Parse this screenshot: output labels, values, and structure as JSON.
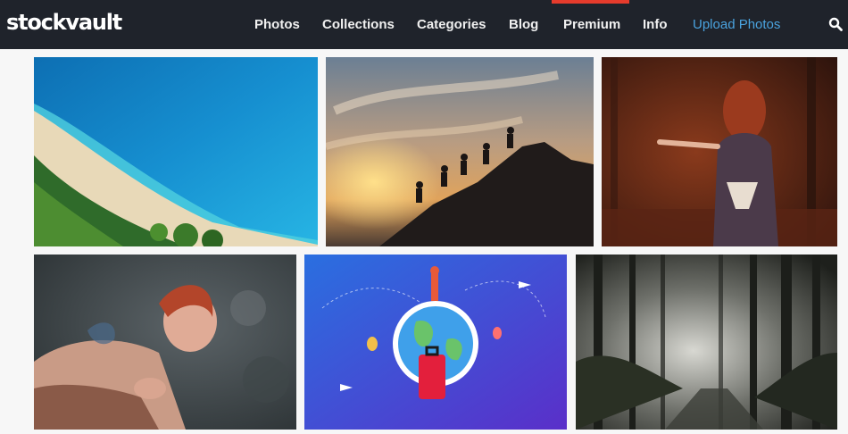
{
  "brand": {
    "logo_text": "stockvault"
  },
  "nav": {
    "items": [
      {
        "label": "Photos"
      },
      {
        "label": "Collections"
      },
      {
        "label": "Categories"
      },
      {
        "label": "Blog"
      },
      {
        "label": "Premium"
      },
      {
        "label": "Info"
      },
      {
        "label": "Upload Photos"
      }
    ],
    "accent_color": "#e53b2c",
    "upload_color": "#4aa3df"
  },
  "icons": {
    "search": "search-icon"
  },
  "gallery": {
    "photos": [
      {
        "subject": "beach-aerial"
      },
      {
        "subject": "mountain-climbers-sunset"
      },
      {
        "subject": "woman-red-hair-forest"
      },
      {
        "subject": "tattooed-woman-portrait"
      },
      {
        "subject": "travel-globe-illustration"
      },
      {
        "subject": "misty-forest-light"
      }
    ]
  }
}
